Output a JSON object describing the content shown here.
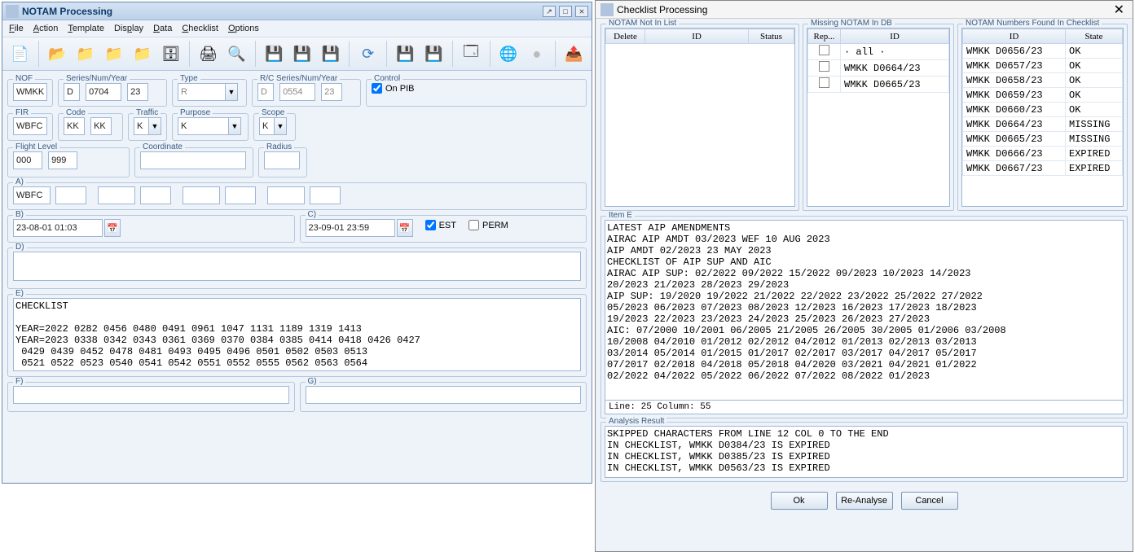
{
  "left": {
    "title": "NOTAM Processing",
    "menu": {
      "file": "File",
      "action": "Action",
      "template": "Template",
      "display": "Display",
      "data": "Data",
      "checklist": "Checklist",
      "options": "Options"
    },
    "toolbar_icons": [
      "document-new",
      "folder-open",
      "folder-in",
      "folder-out",
      "folder-forward",
      "database",
      "printer",
      "search",
      "bracket-save-green",
      "bracket-save-in",
      "bracket-save-out",
      "refresh",
      "save-disk",
      "save-ref",
      "view-small",
      "globe",
      "circle-disabled",
      "export"
    ],
    "labels": {
      "nof": "NOF",
      "series": "Series/Num/Year",
      "type": "Type",
      "rc": "R/C Series/Num/Year",
      "control": "Control",
      "onpib": "On PIB",
      "fir": "FIR",
      "code": "Code",
      "traffic": "Traffic",
      "purpose": "Purpose",
      "scope": "Scope",
      "flightlevel": "Flight Level",
      "coordinate": "Coordinate",
      "radius": "Radius",
      "a": "A)",
      "b": "B)",
      "c": "C)",
      "d": "D)",
      "e": "E)",
      "f": "F)",
      "g": "G)",
      "est": "EST",
      "perm": "PERM"
    },
    "values": {
      "nof": "WMKK",
      "seriesL": "D",
      "seriesN": "0704",
      "seriesY": "23",
      "type": "R",
      "rcL": "D",
      "rcN": "0554",
      "rcY": "23",
      "onpib": true,
      "fir": "WBFC",
      "code1": "KK",
      "code2": "KK",
      "traffic": "K",
      "purpose": "K",
      "scope": "K",
      "fl1": "000",
      "fl2": "999",
      "coordinate": "",
      "radius": "",
      "a": "WBFC",
      "b": "23-08-01 01:03",
      "c": "23-09-01 23:59",
      "est": true,
      "perm": false,
      "d": "",
      "e": "CHECKLIST\n\nYEAR=2022 0282 0456 0480 0491 0961 1047 1131 1189 1319 1413\nYEAR=2023 0338 0342 0343 0361 0369 0370 0384 0385 0414 0418 0426 0427\n 0429 0439 0452 0478 0481 0493 0495 0496 0501 0502 0503 0513\n 0521 0522 0523 0540 0541 0542 0551 0552 0555 0562 0563 0564",
      "f": "",
      "g": ""
    }
  },
  "right": {
    "title": "Checklist Processing",
    "sections": {
      "notInList": "NOTAM Not In List",
      "missing": "Missing NOTAM In DB",
      "found": "NOTAM Numbers Found In Checklist",
      "itemE": "Item E",
      "analysis": "Analysis Result"
    },
    "notInList": {
      "cols": [
        "Delete",
        "ID",
        "Status"
      ],
      "rows": []
    },
    "missing": {
      "cols": [
        "Rep...",
        "ID"
      ],
      "rows": [
        {
          "id": "· all ·"
        },
        {
          "id": "WMKK D0664/23"
        },
        {
          "id": "WMKK D0665/23"
        }
      ]
    },
    "found": {
      "cols": [
        "ID",
        "State"
      ],
      "rows": [
        {
          "id": "WMKK D0656/23",
          "state": "OK"
        },
        {
          "id": "WMKK D0657/23",
          "state": "OK"
        },
        {
          "id": "WMKK D0658/23",
          "state": "OK"
        },
        {
          "id": "WMKK D0659/23",
          "state": "OK"
        },
        {
          "id": "WMKK D0660/23",
          "state": "OK"
        },
        {
          "id": "WMKK D0664/23",
          "state": "MISSING"
        },
        {
          "id": "WMKK D0665/23",
          "state": "MISSING"
        },
        {
          "id": "WMKK D0666/23",
          "state": "EXPIRED"
        },
        {
          "id": "WMKK D0667/23",
          "state": "EXPIRED"
        }
      ]
    },
    "itemE_text": "LATEST AIP AMENDMENTS\nAIRAC AIP AMDT 03/2023 WEF 10 AUG 2023\nAIP AMDT 02/2023 23 MAY 2023\nCHECKLIST OF AIP SUP AND AIC\nAIRAC AIP SUP: 02/2022 09/2022 15/2022 09/2023 10/2023 14/2023\n20/2023 21/2023 28/2023 29/2023\nAIP SUP: 19/2020 19/2022 21/2022 22/2022 23/2022 25/2022 27/2022\n05/2023 06/2023 07/2023 08/2023 12/2023 16/2023 17/2023 18/2023\n19/2023 22/2023 23/2023 24/2023 25/2023 26/2023 27/2023\nAIC: 07/2000 10/2001 06/2005 21/2005 26/2005 30/2005 01/2006 03/2008\n10/2008 04/2010 01/2012 02/2012 04/2012 01/2013 02/2013 03/2013\n03/2014 05/2014 01/2015 01/2017 02/2017 03/2017 04/2017 05/2017\n07/2017 02/2018 04/2018 05/2018 04/2020 03/2021 04/2021 01/2022\n02/2022 04/2022 05/2022 06/2022 07/2022 08/2022 01/2023",
    "itemE_status": "Line: 25 Column: 55",
    "analysis_text": "SKIPPED CHARACTERS FROM LINE 12 COL 0 TO THE END\nIN CHECKLIST, WMKK D0384/23 IS EXPIRED\nIN CHECKLIST, WMKK D0385/23 IS EXPIRED\nIN CHECKLIST, WMKK D0563/23 IS EXPIRED",
    "buttons": {
      "ok": "Ok",
      "reanalyse": "Re-Analyse",
      "cancel": "Cancel"
    }
  }
}
